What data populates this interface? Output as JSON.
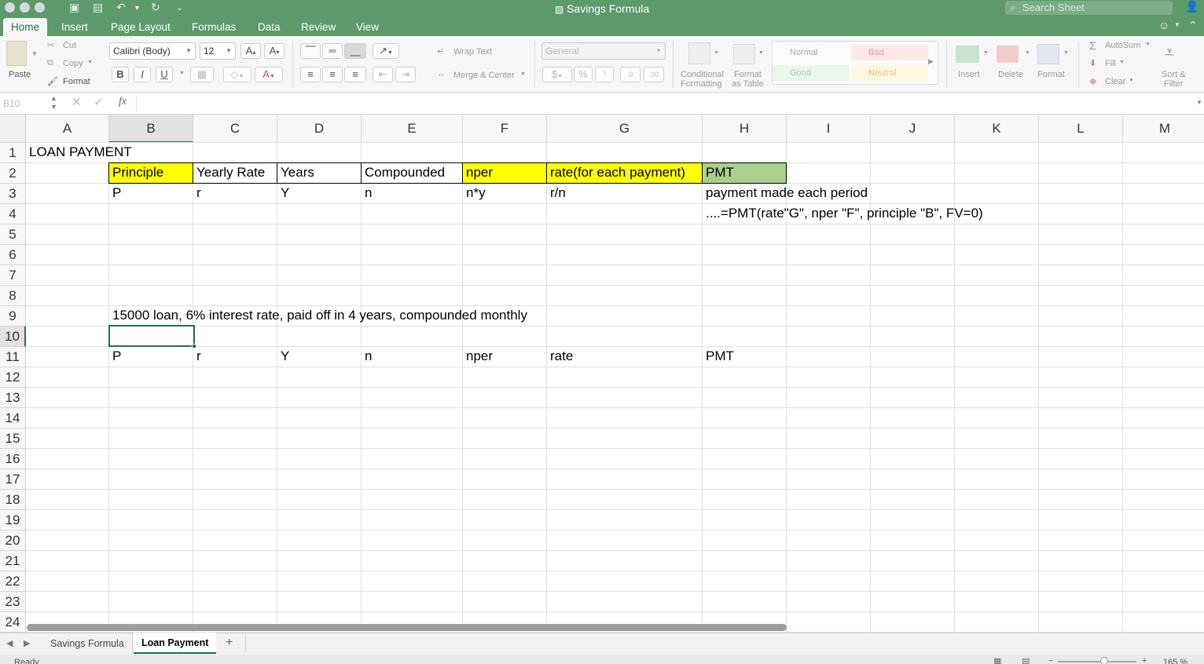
{
  "window": {
    "title": "Savings Formula",
    "search_placeholder": "Search Sheet"
  },
  "ribbon_tabs": [
    "Home",
    "Insert",
    "Page Layout",
    "Formulas",
    "Data",
    "Review",
    "View"
  ],
  "ribbon": {
    "paste": "Paste",
    "cut": "Cut",
    "copy": "Copy",
    "format_painter": "Format",
    "font_name": "Calibri (Body)",
    "font_size": "12",
    "bold": "B",
    "italic": "I",
    "underline": "U",
    "wrap_text": "Wrap Text",
    "merge_center": "Merge & Center",
    "number_format": "General",
    "conditional_formatting_1": "Conditional",
    "conditional_formatting_2": "Formatting",
    "format_table_1": "Format",
    "format_table_2": "as Table",
    "styles": {
      "normal": "Normal",
      "bad": "Bad",
      "good": "Good",
      "neutral": "Neutral"
    },
    "insert": "Insert",
    "delete": "Delete",
    "format": "Format",
    "autosum": "AutoSum",
    "fill": "Fill",
    "clear": "Clear",
    "sort_filter_1": "Sort &",
    "sort_filter_2": "Filter"
  },
  "formula_bar": {
    "name_box": "B10",
    "fx": "fx",
    "formula": ""
  },
  "columns": [
    "A",
    "B",
    "C",
    "D",
    "E",
    "F",
    "G",
    "H",
    "I",
    "J",
    "K",
    "L",
    "M"
  ],
  "rows": [
    "1",
    "2",
    "3",
    "4",
    "5",
    "6",
    "7",
    "8",
    "9",
    "10",
    "11",
    "12",
    "13",
    "14",
    "15",
    "16",
    "17",
    "18",
    "19",
    "20",
    "21",
    "22",
    "23",
    "24"
  ],
  "cells": {
    "A1": "LOAN PAYMENT",
    "B2": "Principle",
    "C2": "Yearly Rate",
    "D2": "Years",
    "E2": "Compounded",
    "F2": "nper",
    "G2": "rate(for each payment)",
    "H2": "PMT",
    "B3": "P",
    "C3": "r",
    "D3": "Y",
    "E3": "n",
    "F3": "n*y",
    "G3": "r/n",
    "H3": "payment made each period",
    "H4": "....=PMT(rate\"G\", nper \"F\", principle \"B\", FV=0)",
    "B9": "15000 loan, 6% interest rate, paid off in 4 years, compounded monthly",
    "B11": "P",
    "C11": "r",
    "D11": "Y",
    "E11": "n",
    "F11": "nper",
    "G11": "rate",
    "H11": "PMT"
  },
  "colors": {
    "accent": "#217346",
    "titlebar": "#5c9a6c",
    "yellow": "#ffff00",
    "green_fill": "#a9d08e"
  },
  "sheet_tabs": [
    "Savings Formula",
    "Loan Payment"
  ],
  "active_sheet": "Loan Payment",
  "status": {
    "ready": "Ready",
    "zoom": "165 %"
  }
}
